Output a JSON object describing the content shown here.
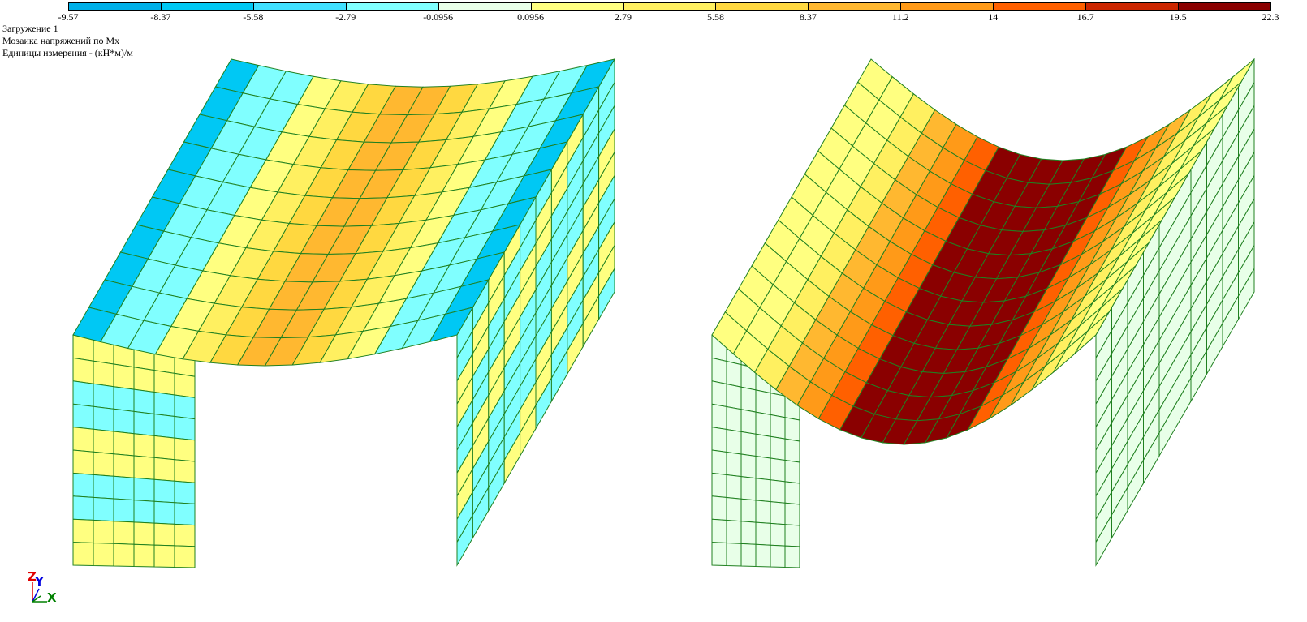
{
  "scale": {
    "colors": [
      "#00b0e8",
      "#00c8f4",
      "#40e0ff",
      "#80ffff",
      "#e8ffe8",
      "#ffff80",
      "#fff060",
      "#ffd840",
      "#ffb830",
      "#ff9a18",
      "#ff6000",
      "#cc2600",
      "#8a0000"
    ],
    "labels": [
      "-9.57",
      "-8.37",
      "-5.58",
      "-2.79",
      "-0.0956",
      "0.0956",
      "2.79",
      "5.58",
      "8.37",
      "11.2",
      "14",
      "16.7",
      "19.5",
      "22.3"
    ]
  },
  "info": {
    "load_case": "Загружение 1",
    "mosaic_title": "Мозаика напряжений по Mx",
    "units": "Единицы измерения - (кН*м)/м"
  },
  "axes": {
    "z": "Z",
    "y": "Y",
    "x": "X"
  },
  "mesh": {
    "line_color": "#208020",
    "left_model": {
      "roof_strips": [
        1,
        3,
        3,
        5,
        6,
        7,
        8,
        8,
        7,
        6,
        5,
        3,
        3,
        1
      ],
      "near_wall_strips": [
        5,
        5,
        3,
        3,
        5,
        5,
        3,
        3,
        5,
        5
      ],
      "far_wall_strips": [
        3,
        3,
        5,
        5,
        3,
        3,
        5,
        5,
        3,
        3
      ]
    },
    "right_model": {
      "roof_strips": [
        5,
        5,
        6,
        8,
        9,
        10,
        12,
        12,
        12,
        12,
        12,
        12,
        10,
        9,
        8,
        6,
        5,
        5
      ],
      "wall_strip": 4
    }
  }
}
